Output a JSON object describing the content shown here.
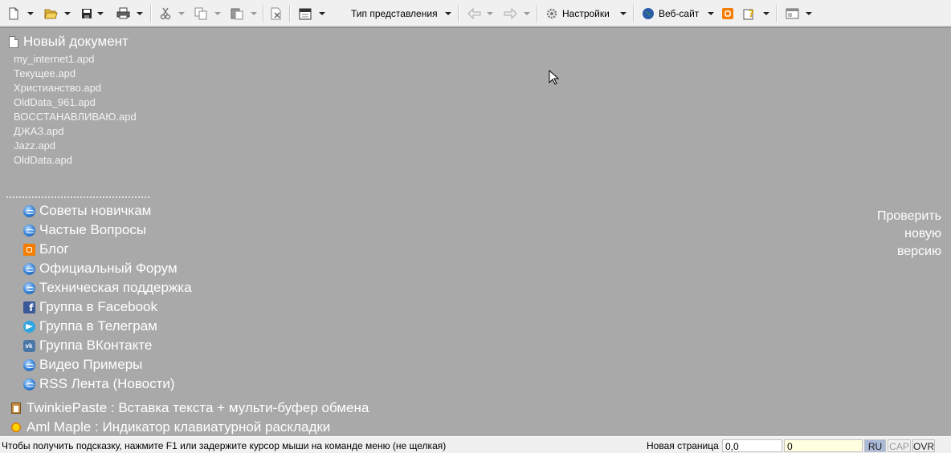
{
  "toolbar": {
    "view_type_label": "Тип представления",
    "settings_label": "Настройки",
    "website_label": "Веб-сайт"
  },
  "start_page": {
    "new_document": "Новый документ",
    "recent_files": [
      "my_internet1.apd",
      "Текущее.apd",
      "Христианство.apd",
      "OldData_961.apd",
      "ВОССТАНАВЛИВАЮ.apd",
      "ДЖАЗ.apd",
      "Jazz.apd",
      "OldData.apd"
    ],
    "links": [
      {
        "label": "Советы новичкам",
        "icon": "globe-icon"
      },
      {
        "label": "Частые Вопросы",
        "icon": "globe-icon"
      },
      {
        "label": "Блог",
        "icon": "blogger-icon"
      },
      {
        "label": "Официальный Форум",
        "icon": "globe-icon"
      },
      {
        "label": "Техническая поддержка",
        "icon": "globe-icon"
      },
      {
        "label": "Группа в Facebook",
        "icon": "facebook-icon"
      },
      {
        "label": "Группа в Телеграм",
        "icon": "telegram-icon"
      },
      {
        "label": "Группа ВКонтакте",
        "icon": "vk-icon"
      },
      {
        "label": "Видео Примеры",
        "icon": "globe-icon"
      },
      {
        "label": "RSS Лента (Новости)",
        "icon": "globe-icon"
      }
    ],
    "extras": [
      {
        "label": "TwinkiePaste : Вставка текста + мульти-буфер обмена",
        "icon": "clipboard-icon"
      },
      {
        "label": "Aml Maple : Индикатор клавиатурной раскладки",
        "icon": "maple-icon"
      }
    ],
    "check_version": [
      "Проверить",
      "новую",
      "версию"
    ]
  },
  "status_bar": {
    "hint": "Чтобы получить подсказку, нажмите F1 или задержите курсор мыши на команде меню (не щелкая)",
    "page_label": "Новая страница",
    "coords": "0,0",
    "count": "0",
    "lang": "RU",
    "cap": "CAP",
    "ovr": "OVR"
  },
  "colors": {
    "workspace_bg": "#a9a9a9",
    "toolbar_bg": "#f0f0f0",
    "link_text": "#ffffff"
  }
}
